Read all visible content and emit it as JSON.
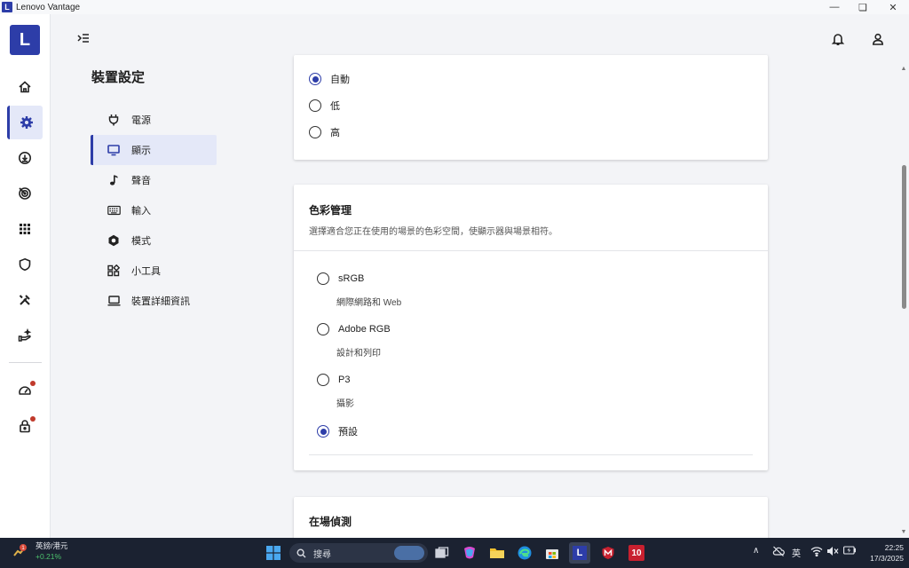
{
  "window": {
    "title": "Lenovo Vantage",
    "app_letter": "L"
  },
  "brand": {
    "letter": "L",
    "color": "#2d3da8"
  },
  "rail": {
    "items": [
      {
        "name": "home-icon"
      },
      {
        "name": "gear-icon",
        "active": true
      },
      {
        "name": "download-icon"
      },
      {
        "name": "radar-icon"
      },
      {
        "name": "apps-grid-icon"
      },
      {
        "name": "shield-icon"
      },
      {
        "name": "tools-icon"
      },
      {
        "name": "hand-sparkle-icon"
      },
      {
        "name": "speedometer-icon",
        "badge": true
      },
      {
        "name": "lock-icon",
        "badge": true
      }
    ]
  },
  "header": {
    "toggle_icon": "menu-collapse-icon",
    "icons": [
      "bell-icon",
      "user-icon"
    ]
  },
  "nav": {
    "title": "裝置設定",
    "items": [
      {
        "label": "電源",
        "icon": "plug-icon"
      },
      {
        "label": "顯示",
        "icon": "monitor-icon",
        "active": true
      },
      {
        "label": "聲音",
        "icon": "music-note-icon"
      },
      {
        "label": "輸入",
        "icon": "keyboard-icon"
      },
      {
        "label": "模式",
        "icon": "hexagon-icon"
      },
      {
        "label": "小工具",
        "icon": "widgets-icon"
      },
      {
        "label": "裝置詳細資訊",
        "icon": "laptop-icon"
      }
    ]
  },
  "level_card": {
    "options": [
      {
        "label": "自動",
        "selected": true
      },
      {
        "label": "低",
        "selected": false
      },
      {
        "label": "高",
        "selected": false
      }
    ]
  },
  "color_card": {
    "title": "色彩管理",
    "description": "選擇適合您正在使用的場景的色彩空間，使顯示器與場景相符。",
    "options": [
      {
        "label": "sRGB",
        "sub": "網際網路和 Web",
        "selected": false
      },
      {
        "label": "Adobe RGB",
        "sub": "設計和列印",
        "selected": false
      },
      {
        "label": "P3",
        "sub": "攝影",
        "selected": false
      },
      {
        "label": "預設",
        "sub": "",
        "selected": true
      }
    ]
  },
  "presence_card": {
    "title": "在場偵測"
  },
  "taskbar": {
    "stock_name": "英鎊/港元",
    "stock_change": "+0.21%",
    "stock_badge": "1",
    "search_placeholder": "搜尋",
    "ime": "英",
    "time": "22:25",
    "date": "17/3/2025",
    "pinned_l": "L",
    "pinned_10": "10"
  }
}
